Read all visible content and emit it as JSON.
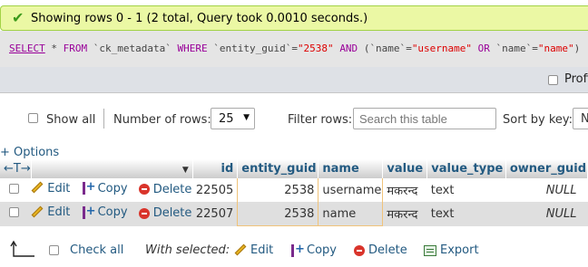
{
  "message": {
    "text": "Showing rows 0 - 1 (2 total, Query took 0.0010 seconds.)",
    "icon": "check-icon",
    "color": "#ebf8a4"
  },
  "query": {
    "select": "SELECT",
    "star": "*",
    "from": "FROM",
    "table": "`ck_metadata`",
    "where": "WHERE",
    "col1": "`entity_guid`",
    "eq1": "=",
    "val1": "\"2538\"",
    "and": "AND",
    "lparen": "(",
    "col2": "`name`",
    "eq2": "=",
    "val2": "\"username\"",
    "or": "OR",
    "col3": "`name`",
    "eq3": "=",
    "val3": "\"name\"",
    "rparen": ")"
  },
  "profiling": {
    "label": "Profi"
  },
  "controls": {
    "show_all": "Show all",
    "number_of_rows_label": "Number of rows:",
    "number_of_rows_value": "25",
    "filter_rows_label": "Filter rows:",
    "search_placeholder": "Search this table",
    "sort_by_key_label": "Sort by key:",
    "sort_by_key_value": "N"
  },
  "options_link": "+ Options",
  "table": {
    "nav_arrows": "←T→",
    "columns": [
      "id",
      "entity_guid",
      "name",
      "value",
      "value_type",
      "owner_guid"
    ],
    "actions": {
      "edit": "Edit",
      "copy": "Copy",
      "delete": "Delete"
    },
    "rows": [
      {
        "id": "22505",
        "entity_guid": "2538",
        "name": "username",
        "value": "मकरन्द",
        "value_type": "text",
        "owner_guid": "NULL"
      },
      {
        "id": "22507",
        "entity_guid": "2538",
        "name": "name",
        "value": "मकरन्द",
        "value_type": "text",
        "owner_guid": "NULL"
      }
    ]
  },
  "bottom": {
    "check_all": "Check all",
    "with_selected": "With selected:",
    "edit": "Edit",
    "copy": "Copy",
    "delete": "Delete",
    "export": "Export"
  }
}
